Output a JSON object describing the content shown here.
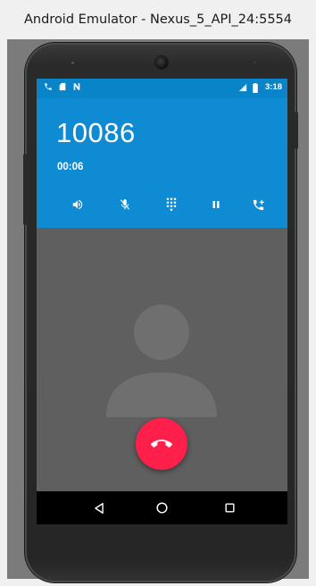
{
  "window": {
    "title": "Android Emulator - Nexus_5_API_24:5554"
  },
  "status_bar": {
    "left_icons": [
      "phone-call-icon",
      "sd-card-icon",
      "n-notification-icon"
    ],
    "right_icons": [
      "signal-icon",
      "battery-icon"
    ],
    "time": "3:18"
  },
  "call": {
    "number": "10086",
    "duration": "00:06",
    "header_color": "#0f8bd4"
  },
  "controls": [
    {
      "name": "speaker",
      "icon": "speaker-icon"
    },
    {
      "name": "mute",
      "icon": "mute-mic-icon"
    },
    {
      "name": "dialpad",
      "icon": "dialpad-icon"
    },
    {
      "name": "hold",
      "icon": "pause-icon"
    },
    {
      "name": "add-call",
      "icon": "add-call-icon"
    }
  ],
  "end_call": {
    "icon": "end-call-icon",
    "color": "#ff1f4b"
  },
  "nav_bar": {
    "buttons": [
      "back-icon",
      "home-icon",
      "recents-icon"
    ]
  }
}
